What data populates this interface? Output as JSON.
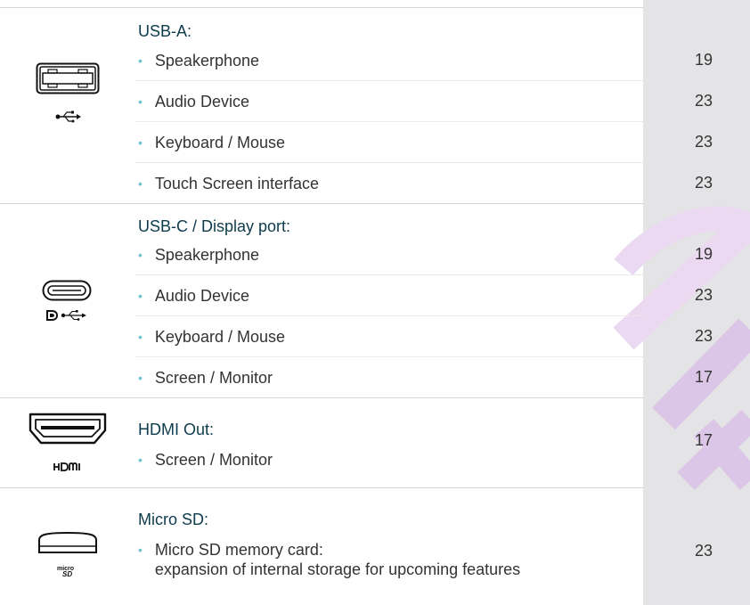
{
  "sections": [
    {
      "title": "USB-A:",
      "icon": "usb-a-port-icon",
      "items": [
        {
          "label": "Speakerphone",
          "page": "19"
        },
        {
          "label": "Audio Device",
          "page": "23"
        },
        {
          "label": "Keyboard / Mouse",
          "page": "23"
        },
        {
          "label": "Touch Screen interface",
          "page": "23"
        }
      ]
    },
    {
      "title": "USB-C / Display port:",
      "icon": "usb-c-port-icon",
      "items": [
        {
          "label": "Speakerphone",
          "page": "19"
        },
        {
          "label": "Audio Device",
          "page": "23"
        },
        {
          "label": "Keyboard / Mouse",
          "page": "23"
        },
        {
          "label": "Screen / Monitor",
          "page": "17"
        }
      ]
    },
    {
      "title": "HDMI Out:",
      "icon": "hdmi-port-icon",
      "icon_label": "HDMI",
      "items": [
        {
          "label": "Screen / Monitor",
          "page": "17"
        }
      ]
    },
    {
      "title": "Micro SD:",
      "icon": "micro-sd-slot-icon",
      "items": [
        {
          "label_line1": "Micro SD memory card:",
          "label_line2": "expansion of internal storage for upcoming features",
          "page": "23"
        }
      ]
    }
  ],
  "colors": {
    "title": "#0e3b4c",
    "bullet": "#6fc3d0",
    "page_column": "#e4e4e6",
    "watermark": "#d9c7e3"
  }
}
